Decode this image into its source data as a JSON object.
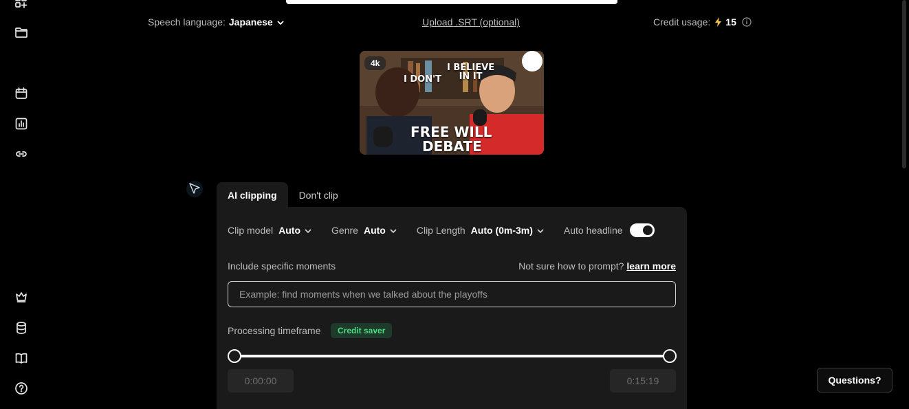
{
  "top": {
    "speech_language_label": "Speech language:",
    "speech_language_value": "Japanese",
    "upload_srt": "Upload .SRT (optional)",
    "credit_usage_label": "Credit usage:",
    "credit_usage_value": "15"
  },
  "thumbnail": {
    "badge": "4k",
    "text_left": "I DON'T",
    "text_right_1": "I BELIEVE",
    "text_right_2": "IN IT",
    "text_title_1": "FREE WILL",
    "text_title_2": "DEBATE"
  },
  "tabs": [
    {
      "label": "AI clipping",
      "active": true
    },
    {
      "label": "Don't clip",
      "active": false
    }
  ],
  "options": {
    "clip_model_label": "Clip model",
    "clip_model_value": "Auto",
    "genre_label": "Genre",
    "genre_value": "Auto",
    "clip_length_label": "Clip Length",
    "clip_length_value": "Auto (0m-3m)",
    "auto_headline_label": "Auto headline",
    "auto_headline_on": true
  },
  "moments": {
    "label": "Include specific moments",
    "help_text": "Not sure how to prompt?",
    "help_link": "learn more",
    "placeholder": "Example: find moments when we talked about the playoffs"
  },
  "timeframe": {
    "label": "Processing timeframe",
    "badge": "Credit saver",
    "start": "0:00:00",
    "end": "0:15:19",
    "range_fraction": [
      0,
      1
    ]
  },
  "questions_button": "Questions?",
  "colors": {
    "background": "#000000",
    "panel": "#1a1a1a",
    "accent_bolt": "#f5c542",
    "badge_green": "#4ade80"
  }
}
